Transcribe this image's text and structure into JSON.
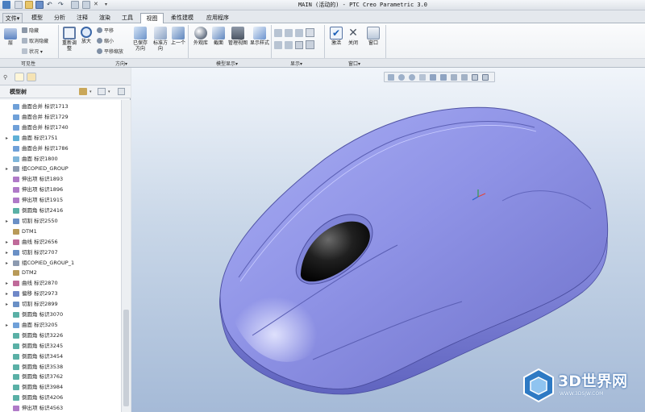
{
  "window": {
    "title": "MAIN (活动的) - PTC Creo Parametric 3.0"
  },
  "tabs": [
    {
      "label": "文件▾"
    },
    {
      "label": "模型"
    },
    {
      "label": "分析"
    },
    {
      "label": "注释"
    },
    {
      "label": "渲染"
    },
    {
      "label": "工具"
    },
    {
      "label": "视图"
    },
    {
      "label": "柔性建模"
    },
    {
      "label": "应用程序"
    }
  ],
  "ribbon": {
    "visibility": {
      "layer": "层",
      "hide": "隐藏",
      "unhide": "取消隐藏",
      "status": "状况 ▾",
      "group": "可见性"
    },
    "orientation": {
      "refit": "重新调整",
      "zoom_in": "放大",
      "pan": "平移",
      "zoom_out": "缩小",
      "pan_zoom": "平移缩放",
      "saved": "已保存方向",
      "standard": "标准方向",
      "previous": "上一个",
      "group": "方向▾"
    },
    "model_display": {
      "appearance": "外观库",
      "section": "截面",
      "manage_views": "管理视图",
      "display_style": "显示样式",
      "group": "模型显示▾"
    },
    "display": {
      "group": "显示▾"
    },
    "window": {
      "activate": "激活",
      "close": "关闭",
      "windows": "窗口",
      "group": "窗口▾"
    }
  },
  "model_tree": {
    "header": "模型树",
    "items": [
      {
        "label": "曲面合并 标识1713",
        "expandable": false
      },
      {
        "label": "曲面合并 标识1729",
        "expandable": false
      },
      {
        "label": "曲面合并 标识1740",
        "expandable": false
      },
      {
        "label": "曲面 标识1751",
        "expandable": true
      },
      {
        "label": "曲面合并 标识1786",
        "expandable": false
      },
      {
        "label": "曲面 标识1800",
        "expandable": false
      },
      {
        "label": "组COPIED_GROUP",
        "expandable": true
      },
      {
        "label": "伸出项 标识1893",
        "expandable": false
      },
      {
        "label": "伸出项 标识1896",
        "expandable": false
      },
      {
        "label": "伸出项 标识1915",
        "expandable": false
      },
      {
        "label": "倒圆角 标识2416",
        "expandable": false
      },
      {
        "label": "切割 标识2550",
        "expandable": true
      },
      {
        "label": "DTM1",
        "expandable": false
      },
      {
        "label": "曲线 标识2656",
        "expandable": true
      },
      {
        "label": "切割 标识2707",
        "expandable": true
      },
      {
        "label": "组COPIED_GROUP_1",
        "expandable": true
      },
      {
        "label": "DTM2",
        "expandable": false
      },
      {
        "label": "曲线 标识2870",
        "expandable": true
      },
      {
        "label": "偏移 标识2973",
        "expandable": true
      },
      {
        "label": "切割 标识2899",
        "expandable": true
      },
      {
        "label": "倒圆角 标识3070",
        "expandable": false
      },
      {
        "label": "曲面 标识3205",
        "expandable": true
      },
      {
        "label": "倒圆角 标识3226",
        "expandable": false
      },
      {
        "label": "倒圆角 标识3245",
        "expandable": false
      },
      {
        "label": "倒圆角 标识3454",
        "expandable": false
      },
      {
        "label": "倒圆角 标识3538",
        "expandable": false
      },
      {
        "label": "倒圆角 标识3762",
        "expandable": false
      },
      {
        "label": "倒圆角 标识3984",
        "expandable": false
      },
      {
        "label": "倒圆角 标识4206",
        "expandable": false
      },
      {
        "label": "伸出项 标识4563",
        "expandable": false
      }
    ]
  },
  "watermark": {
    "text": "3D世界网",
    "url": "WWW.3DSJW.COM"
  },
  "colors": {
    "model_body": "#8f93e6",
    "model_scroll_wheel": "#151515",
    "viewport_top": "#f1f5fa",
    "viewport_bottom": "#a5bad7"
  }
}
